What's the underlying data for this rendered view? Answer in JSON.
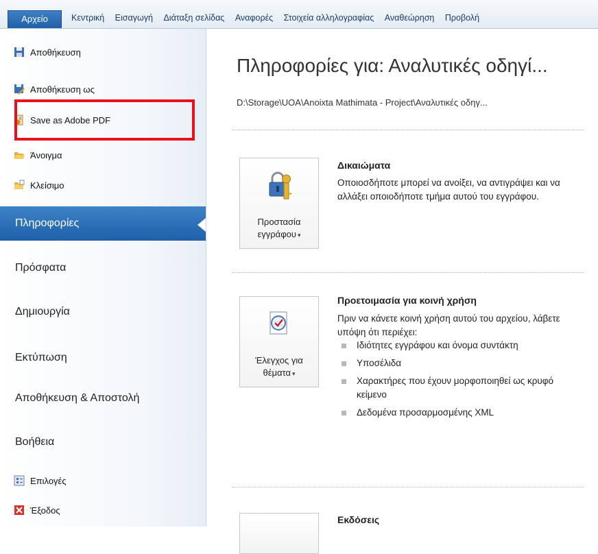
{
  "ribbon": {
    "file_tab": "Αρχείο",
    "tabs": [
      "Κεντρική",
      "Εισαγωγή",
      "Διάταξη σελίδας",
      "Αναφορές",
      "Στοιχεία αλληλογραφίας",
      "Αναθεώρηση",
      "Προβολή"
    ]
  },
  "nav": {
    "commands": [
      {
        "label": "Αποθήκευση",
        "icon": "save-icon"
      },
      {
        "label": "Αποθήκευση ως",
        "icon": "save-as-icon"
      },
      {
        "label": "Save as Adobe PDF",
        "icon": "adobe-pdf-icon"
      },
      {
        "label": "Άνοιγμα",
        "icon": "open-folder-icon"
      },
      {
        "label": "Κλείσιμο",
        "icon": "close-folder-icon"
      }
    ],
    "sections": [
      "Πληροφορίες",
      "Πρόσφατα",
      "Δημιουργία",
      "Εκτύπωση",
      "Αποθήκευση & Αποστολή",
      "Βοήθεια"
    ],
    "selected": "Πληροφορίες",
    "bottom": [
      {
        "label": "Επιλογές",
        "icon": "options-icon"
      },
      {
        "label": "Έξοδος",
        "icon": "exit-icon"
      }
    ]
  },
  "info": {
    "title": "Πληροφορίες για: Αναλυτικές οδηγί...",
    "path": "D:\\Storage\\UOA\\Anoixta Mathimata - Project\\Αναλυτικές οδηγ...",
    "permissions": {
      "button_line1": "Προστασία",
      "button_line2": "εγγράφου",
      "heading": "Δικαιώματα",
      "text": "Οποιοσδήποτε μπορεί να ανοίξει, να αντιγράψει και να αλλάξει οποιοδήποτε τμήμα αυτού του εγγράφου."
    },
    "prepare": {
      "button_line1": "Έλεγχος για",
      "button_line2": "θέματα",
      "heading": "Προετοιμασία για κοινή χρήση",
      "text": "Πριν να κάνετε κοινή χρήση αυτού του αρχείου, λάβετε υπόψη ότι περιέχει:",
      "items": [
        "Ιδιότητες εγγράφου και όνομα συντάκτη",
        "Υποσέλιδα",
        "Χαρακτήρες που έχουν μορφοποιηθεί ως κρυφό κείμενο",
        "Δεδομένα προσαρμοσμένης XML"
      ]
    },
    "versions": {
      "heading": "Εκδόσεις"
    }
  }
}
